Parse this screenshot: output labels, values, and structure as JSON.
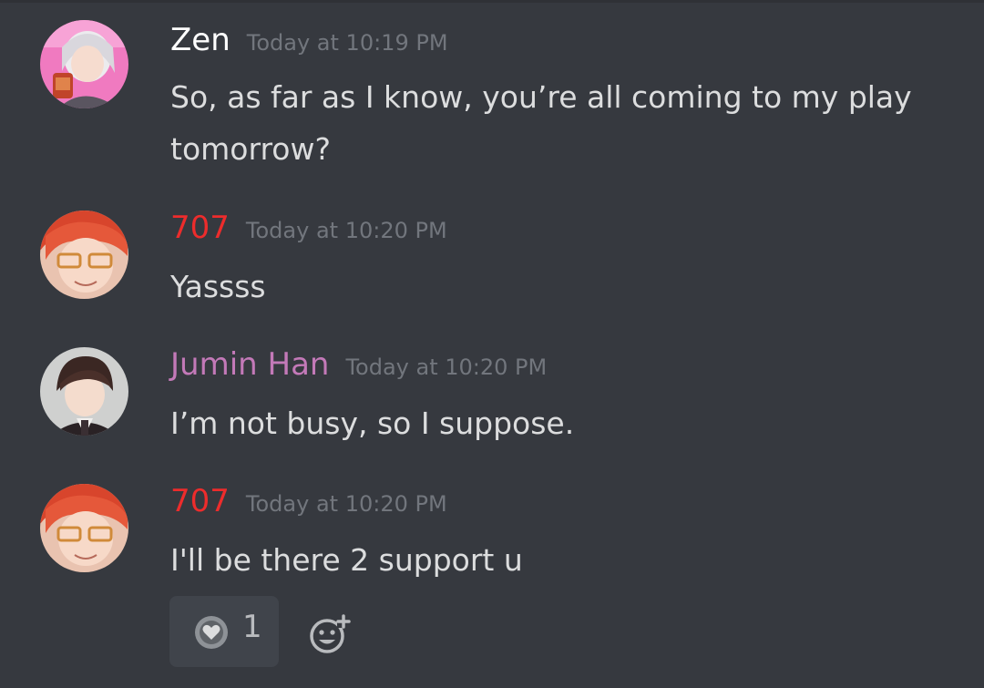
{
  "messages": [
    {
      "author": "Zen",
      "author_color": "#ffffff",
      "timestamp": "Today at 10:19 PM",
      "text": "So, as far as I know, you’re all coming to my play tomorrow?",
      "avatar": "zen-avatar"
    },
    {
      "author": "707",
      "author_color": "#ed2c2c",
      "timestamp": "Today at 10:20 PM",
      "text": "Yassss",
      "avatar": "707-avatar"
    },
    {
      "author": "Jumin Han",
      "author_color": "#c379b8",
      "timestamp": "Today at 10:20 PM",
      "text": "I’m not busy, so I suppose.",
      "avatar": "jumin-avatar"
    },
    {
      "author": "707",
      "author_color": "#ed2c2c",
      "timestamp": "Today at 10:20 PM",
      "text": "I'll be there 2 support u",
      "avatar": "707-avatar"
    }
  ],
  "reaction": {
    "emoji": "heart-emoji",
    "count": "1"
  },
  "add_reaction_icon": "add-reaction-icon",
  "colors": {
    "background": "#36393f",
    "text": "#dcddde",
    "timestamp": "#72767d",
    "reaction_bg": "#40444b"
  }
}
